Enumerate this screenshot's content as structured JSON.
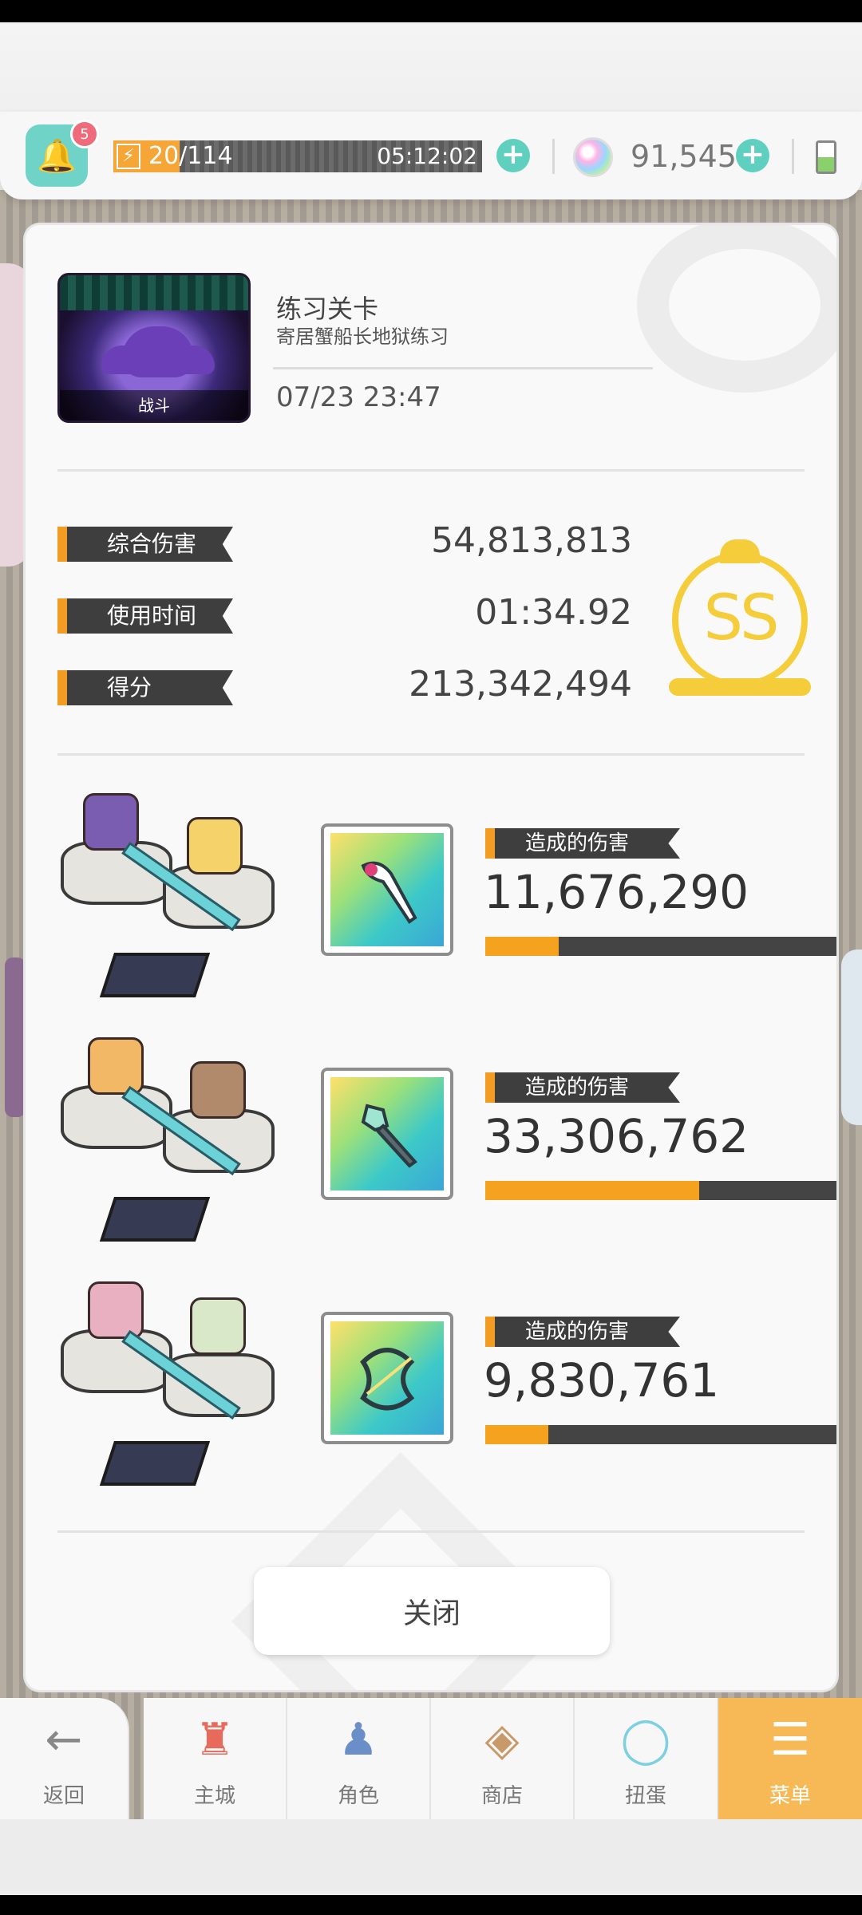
{
  "status_bar": {
    "stamina_value": "20/114",
    "stamina_fill": 0.18,
    "stamina_timer": "05:12:02",
    "gem_count": "91,545",
    "notification_badge": "5"
  },
  "stage": {
    "thumbnail_label": "战斗",
    "title": "练习关卡",
    "subtitle": "寄居蟹船长地狱练习",
    "datetime": "07/23 23:47"
  },
  "stats": [
    {
      "label": "综合伤害",
      "value": "54,813,813"
    },
    {
      "label": "使用时间",
      "value": "01:34.92"
    },
    {
      "label": "得分",
      "value": "213,342,494"
    }
  ],
  "rank": "SS",
  "teams": [
    {
      "damage_label": "造成的伤害",
      "damage": "11,676,290",
      "fill": 0.21,
      "weapon_icon": "staff-icon"
    },
    {
      "damage_label": "造成的伤害",
      "damage": "33,306,762",
      "fill": 0.61,
      "weapon_icon": "mace-icon"
    },
    {
      "damage_label": "造成的伤害",
      "damage": "9,830,761",
      "fill": 0.18,
      "weapon_icon": "bow-icon"
    }
  ],
  "close_label": "关闭",
  "nav": [
    {
      "label": "返回",
      "icon": "back-arrow-icon"
    },
    {
      "label": "主城",
      "icon": "castle-icon"
    },
    {
      "label": "角色",
      "icon": "character-icon"
    },
    {
      "label": "商店",
      "icon": "shop-icon"
    },
    {
      "label": "扭蛋",
      "icon": "gacha-icon"
    },
    {
      "label": "菜单",
      "icon": "menu-icon"
    }
  ],
  "colors": {
    "accent_orange": "#f39c24",
    "rank_gold": "#f5cd3a",
    "teal": "#5fcfbf"
  }
}
